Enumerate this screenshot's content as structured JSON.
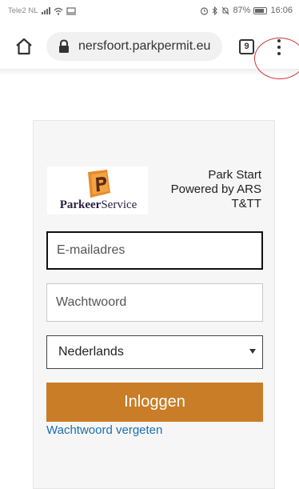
{
  "status_bar": {
    "carrier": "Tele2 NL",
    "battery": "87%",
    "time": "16:06"
  },
  "browser": {
    "url": "nersfoort.parkpermit.eu",
    "tab_count": "9"
  },
  "logo": {
    "word1": "Parkeer",
    "word2": "Service"
  },
  "brand": {
    "line1": "Park Start",
    "line2": "Powered by ARS",
    "line3": "T&TT"
  },
  "form": {
    "email_placeholder": "E-mailadres",
    "password_placeholder": "Wachtwoord",
    "language_selected": "Nederlands",
    "login_label": "Inloggen",
    "forgot_label": "Wachtwoord vergeten"
  },
  "colors": {
    "login_button": "#c97d27",
    "link": "#1a6fb0",
    "annotation_circle": "#d23232"
  }
}
